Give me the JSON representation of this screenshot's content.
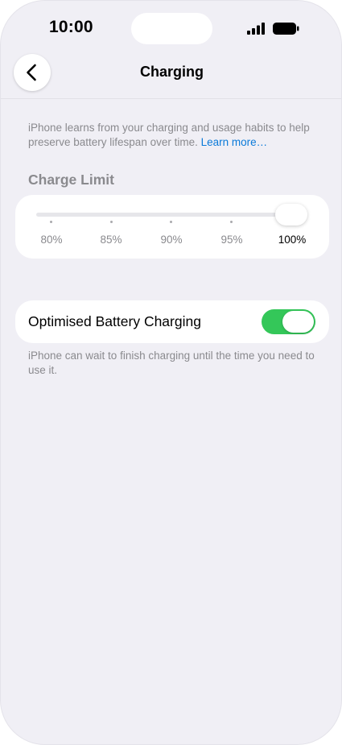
{
  "status_bar": {
    "time": "10:00",
    "signal_icon": "cellular-signal-icon",
    "battery_icon": "battery-full-icon"
  },
  "nav": {
    "back_icon": "chevron-left-icon",
    "title": "Charging"
  },
  "intro": {
    "text": "iPhone learns from your charging and usage habits to help preserve battery lifespan over time. ",
    "link": "Learn more…"
  },
  "charge_limit": {
    "header": "Charge Limit",
    "options": [
      "80%",
      "85%",
      "90%",
      "95%",
      "100%"
    ],
    "selected": "100%",
    "selected_index": 4
  },
  "optimised": {
    "label": "Optimised Battery Charging",
    "enabled": true,
    "footer": "iPhone can wait to finish charging until the time you need to use it."
  },
  "colors": {
    "background": "#f0eff5",
    "toggle_on": "#34c759",
    "link": "#0a7ad9",
    "secondary_text": "#8a8a8e"
  }
}
